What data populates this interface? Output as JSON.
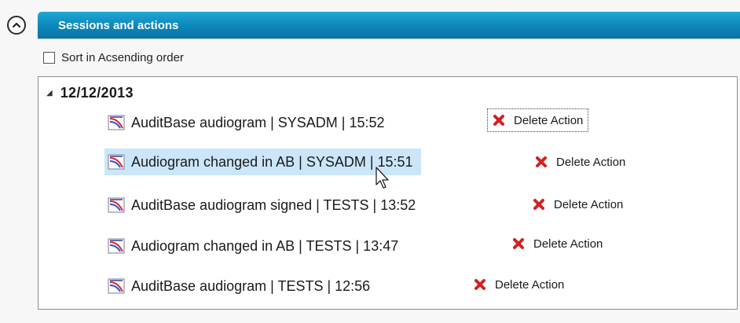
{
  "header": {
    "title": "Sessions and actions"
  },
  "sort": {
    "label": "Sort in Acsending order",
    "checked": false
  },
  "tree": {
    "date": "12/12/2013",
    "items": [
      {
        "label": "AuditBase audiogram | SYSADM | 15:52",
        "action": "Delete Action"
      },
      {
        "label": "Audiogram changed in AB | SYSADM | 15:51",
        "action": "Delete Action"
      },
      {
        "label": "AuditBase audiogram signed | TESTS | 13:52",
        "action": "Delete Action"
      },
      {
        "label": "Audiogram changed in AB | TESTS | 13:47",
        "action": "Delete Action"
      },
      {
        "label": "AuditBase audiogram | TESTS | 12:56",
        "action": "Delete Action"
      }
    ]
  },
  "icons": {
    "collapse": "chevron-up-circle-icon",
    "item": "audiogram-icon",
    "delete": "red-x-icon",
    "cursor": "mouse-pointer"
  },
  "colors": {
    "header": "#0c86b9",
    "selection": "#cbe6f8",
    "delete": "#d42020"
  }
}
